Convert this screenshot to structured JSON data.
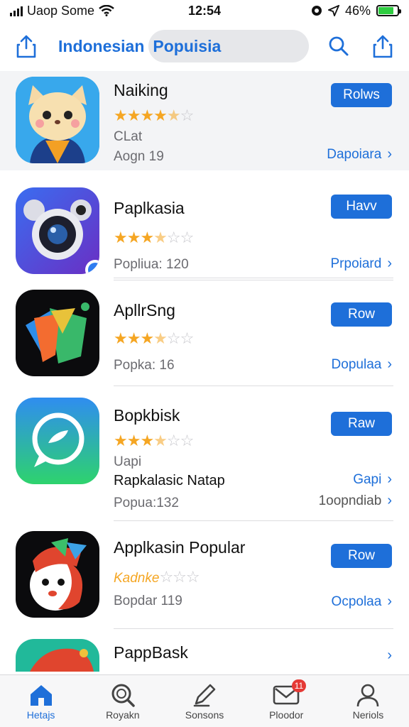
{
  "status_bar": {
    "carrier": "Uaop Some",
    "time": "12:54",
    "battery": "46%"
  },
  "header": {
    "title": "Indonesian",
    "search_text": "Popuisia"
  },
  "apps": [
    {
      "name": "Naiking",
      "rating": 4.5,
      "meta1": "CLat",
      "meta2": "Aogn 19",
      "action": "Rolws",
      "link": "Dapoiara"
    },
    {
      "name": "Paplkasia",
      "rating": 3.5,
      "meta1": "Popliua: 120",
      "action": "Havv",
      "link": "Prpoiard"
    },
    {
      "name": "ApllrSng",
      "rating": 3.5,
      "meta1": "Popka: 16",
      "action": "Row",
      "link": "Dopulaa"
    },
    {
      "name": "Bopkbisk",
      "rating": 3.5,
      "meta1": "Uapi",
      "meta2": "Rapkalasic Natap",
      "meta3": "Popua:132",
      "action": "Raw",
      "link": "Gapi",
      "link2": "1oopndiab"
    },
    {
      "name": "Applkasin Popular",
      "rating": 2,
      "rating_text": "Kadnke",
      "meta1": "Bopdar 119",
      "action": "Row",
      "link": "Ocpolaa"
    },
    {
      "name": "PappBask"
    }
  ],
  "tabbar": [
    {
      "label": "Hetajs",
      "icon": "home-icon",
      "active": true
    },
    {
      "label": "Royakn",
      "icon": "search-icon"
    },
    {
      "label": "Sonsons",
      "icon": "edit-icon"
    },
    {
      "label": "Ploodor",
      "icon": "mail-icon",
      "badge": "11"
    },
    {
      "label": "Neriols",
      "icon": "person-icon"
    }
  ],
  "colors": {
    "accent": "#1e6fd9",
    "star": "#f5a623",
    "badge": "#e53935"
  }
}
